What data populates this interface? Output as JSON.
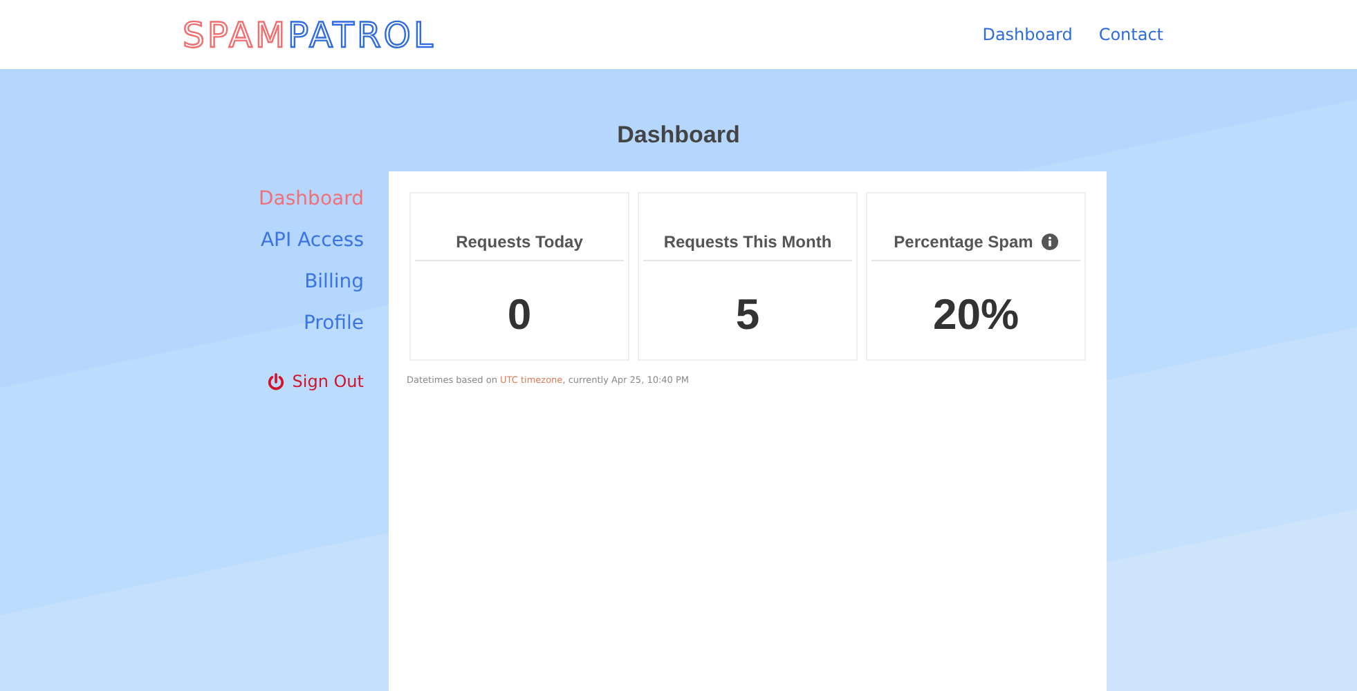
{
  "logo": {
    "first": "SPAM",
    "second": "PATROL"
  },
  "nav": [
    {
      "label": "Dashboard"
    },
    {
      "label": "Contact"
    }
  ],
  "page_title": "Dashboard",
  "sidebar": {
    "items": [
      {
        "label": "Dashboard",
        "selected": true
      },
      {
        "label": "API Access",
        "selected": false
      },
      {
        "label": "Billing",
        "selected": false
      },
      {
        "label": "Profile",
        "selected": false
      }
    ],
    "sign_out": "Sign Out"
  },
  "stats": [
    {
      "title": "Requests Today",
      "value": "0",
      "info": false
    },
    {
      "title": "Requests This Month",
      "value": "5",
      "info": false
    },
    {
      "title": "Percentage Spam",
      "value": "20%",
      "info": true
    }
  ],
  "note": {
    "before": "Datetimes based on ",
    "link": "UTC timezone",
    "after": ", currently Apr 25, 10:40 PM"
  }
}
